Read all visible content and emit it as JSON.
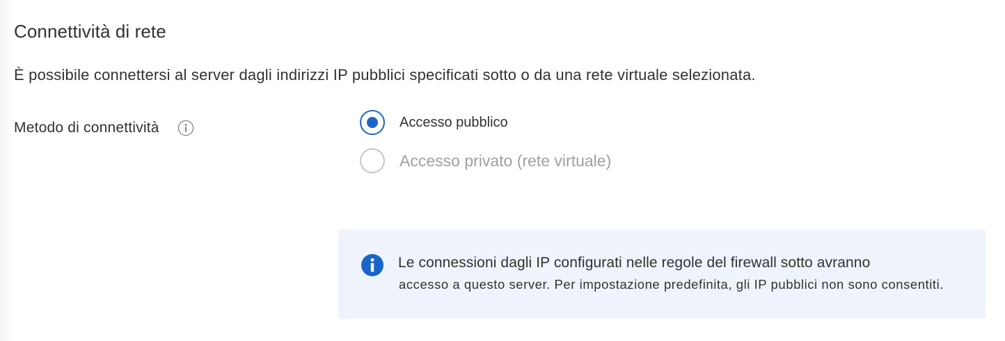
{
  "section": {
    "title": "Connettività di rete",
    "description": "È possibile connettersi al server dagli indirizzi IP pubblici specificati sotto o da una rete virtuale selezionata."
  },
  "connectivity_method": {
    "label": "Metodo di connettività",
    "info_icon": "info-circle-icon",
    "options": [
      {
        "label": "Accesso pubblico",
        "selected": true,
        "enabled": true
      },
      {
        "label": "Accesso privato (rete virtuale)",
        "selected": false,
        "enabled": false
      }
    ]
  },
  "info_message": {
    "icon": "info-filled-icon",
    "line1": "Le connessioni dagli IP configurati nelle regole del firewall sotto avranno",
    "line2": "accesso a questo server. Per impostazione predefinita, gli IP pubblici non sono consentiti."
  },
  "colors": {
    "accent": "#1a66c8",
    "info_background": "#eff4fc",
    "text": "#323130",
    "disabled_text": "#a19f9d"
  }
}
